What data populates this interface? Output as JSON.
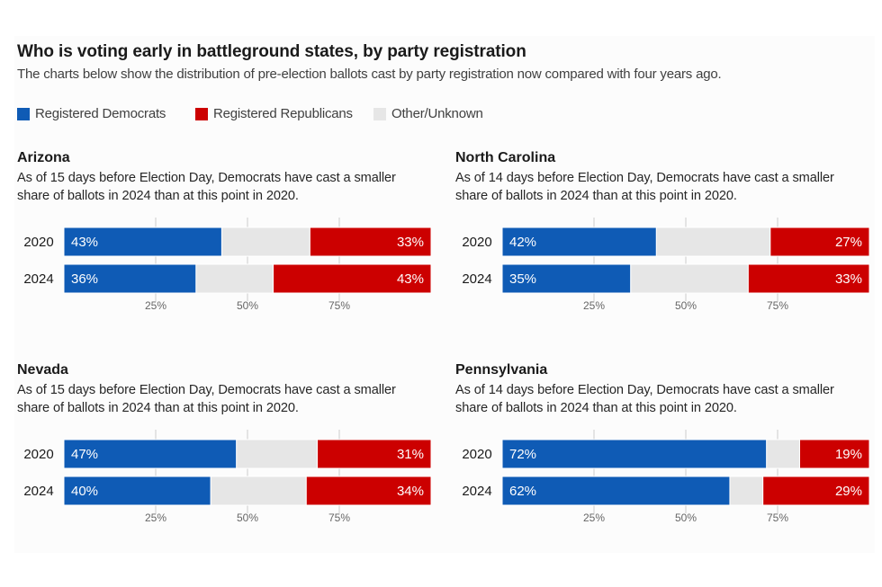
{
  "chart_data": {
    "type": "bar",
    "orientation": "horizontal-stacked",
    "title": "Who is voting early in battleground states, by party registration",
    "subtitle": "The charts below show the distribution of pre-election ballots cast by party registration now compared with four years ago.",
    "legend": [
      {
        "name": "Registered Democrats",
        "color": "#0f5bb5"
      },
      {
        "name": "Registered Republicans",
        "color": "#cc0000"
      },
      {
        "name": "Other/Unknown",
        "color": "#e6e6e6"
      }
    ],
    "x_range": [
      0,
      100
    ],
    "x_ticks": [
      25,
      50,
      75
    ],
    "x_tick_labels": [
      "25%",
      "50%",
      "75%"
    ],
    "grid": true,
    "legend_position": "top-left",
    "panels": [
      {
        "state": "Arizona",
        "description": "As of 15 days before Election Day, Democrats have cast a smaller share of ballots in 2024 than at this point in 2020.",
        "categories": [
          "2020",
          "2024"
        ],
        "series": [
          {
            "name": "Registered Democrats",
            "values": [
              43,
              36
            ]
          },
          {
            "name": "Other/Unknown",
            "values": [
              24,
              21
            ]
          },
          {
            "name": "Registered Republicans",
            "values": [
              33,
              43
            ]
          }
        ]
      },
      {
        "state": "North Carolina",
        "description": "As of 14 days before Election Day, Democrats have cast a smaller share of ballots in 2024 than at this point in 2020.",
        "categories": [
          "2020",
          "2024"
        ],
        "series": [
          {
            "name": "Registered Democrats",
            "values": [
              42,
              35
            ]
          },
          {
            "name": "Other/Unknown",
            "values": [
              31,
              32
            ]
          },
          {
            "name": "Registered Republicans",
            "values": [
              27,
              33
            ]
          }
        ]
      },
      {
        "state": "Nevada",
        "description": "As of 15 days before Election Day, Democrats have cast a smaller share of ballots in 2024 than at this point in 2020.",
        "categories": [
          "2020",
          "2024"
        ],
        "series": [
          {
            "name": "Registered Democrats",
            "values": [
              47,
              40
            ]
          },
          {
            "name": "Other/Unknown",
            "values": [
              22,
              26
            ]
          },
          {
            "name": "Registered Republicans",
            "values": [
              31,
              34
            ]
          }
        ]
      },
      {
        "state": "Pennsylvania",
        "description": "As of 14 days before Election Day, Democrats have cast a smaller share of ballots in 2024 than at this point in 2020.",
        "categories": [
          "2020",
          "2024"
        ],
        "series": [
          {
            "name": "Registered Democrats",
            "values": [
              72,
              62
            ]
          },
          {
            "name": "Other/Unknown",
            "values": [
              9,
              9
            ]
          },
          {
            "name": "Registered Republicans",
            "values": [
              19,
              29
            ]
          }
        ]
      }
    ]
  }
}
